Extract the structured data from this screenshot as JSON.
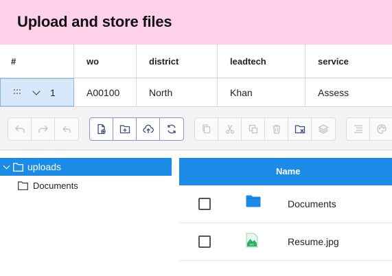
{
  "header": {
    "title": "Upload and store files"
  },
  "grid": {
    "columns": [
      "#",
      "wo",
      "district",
      "leadtech",
      "service"
    ],
    "row": {
      "number": "1",
      "wo": "A00100",
      "district": "North",
      "leadtech": "Khan",
      "service": "Assess"
    }
  },
  "toolbar": {
    "groups": [
      {
        "state": "disabled",
        "icons": [
          "undo-icon",
          "redo-icon",
          "reply-icon"
        ]
      },
      {
        "state": "active",
        "icons": [
          "new-file-icon",
          "new-folder-icon",
          "upload-icon",
          "refresh-icon"
        ]
      },
      {
        "state": "disabled",
        "icons": [
          "copy-icon",
          "cut-icon",
          "paste-icon",
          "delete-icon",
          "clear-selection-icon",
          "layers-icon"
        ]
      },
      {
        "state": "disabled",
        "icons": [
          "details-icon",
          "palette-icon"
        ]
      }
    ]
  },
  "tree": {
    "root": {
      "label": "uploads",
      "expanded": true
    },
    "children": [
      {
        "label": "Documents"
      }
    ]
  },
  "files": {
    "header": {
      "name": "Name"
    },
    "rows": [
      {
        "name": "Documents",
        "type": "folder",
        "checked": false
      },
      {
        "name": "Resume.jpg",
        "type": "image",
        "checked": false
      }
    ]
  },
  "colors": {
    "header_bg": "#fdd1ea",
    "accent": "#1a8ce8",
    "selected_cell": "#d7e8fb"
  }
}
